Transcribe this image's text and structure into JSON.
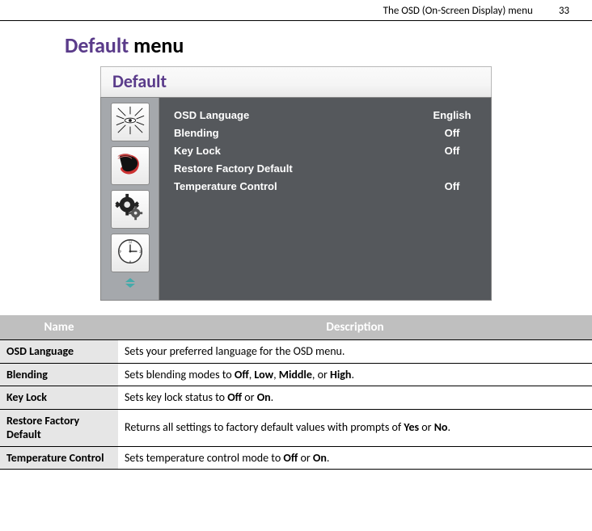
{
  "page_header": {
    "section": "The OSD (On-Screen Display) menu",
    "page_number": "33"
  },
  "page_title_accent": "Default",
  "page_title_rest": " menu",
  "osd": {
    "title": "Default",
    "sidebar_icons": [
      {
        "name": "iris-icon"
      },
      {
        "name": "streamline-icon"
      },
      {
        "name": "gear-icon"
      },
      {
        "name": "clock-icon"
      }
    ],
    "items": [
      {
        "label": "OSD Language",
        "value": "English"
      },
      {
        "label": "Blending",
        "value": "Off"
      },
      {
        "label": "Key Lock",
        "value": "Off"
      },
      {
        "label": "Restore Factory Default",
        "value": ""
      },
      {
        "label": "Temperature Control",
        "value": "Off"
      }
    ]
  },
  "table": {
    "headers": {
      "name": "Name",
      "desc": "Description"
    },
    "rows": [
      {
        "name": "OSD Language",
        "desc_pre": "Sets your preferred language for the OSD menu.",
        "bold1": "",
        "mid1": "",
        "bold2": "",
        "mid2": "",
        "bold3": "",
        "mid3": "",
        "bold4": "",
        "post": ""
      },
      {
        "name": "Blending",
        "desc_pre": "Sets blending modes to ",
        "bold1": "Off",
        "mid1": ", ",
        "bold2": "Low",
        "mid2": ", ",
        "bold3": "Middle",
        "mid3": ", or ",
        "bold4": "High",
        "post": "."
      },
      {
        "name": "Key Lock",
        "desc_pre": "Sets key lock status to ",
        "bold1": "Off",
        "mid1": " or ",
        "bold2": "On",
        "mid2": "",
        "bold3": "",
        "mid3": "",
        "bold4": "",
        "post": "."
      },
      {
        "name": "Restore Factory Default",
        "desc_pre": "Returns all settings to factory default values with prompts of ",
        "bold1": "Yes",
        "mid1": " or ",
        "bold2": "No",
        "mid2": "",
        "bold3": "",
        "mid3": "",
        "bold4": "",
        "post": "."
      },
      {
        "name": "Temperature Control",
        "desc_pre": "Sets temperature control mode to ",
        "bold1": "Off",
        "mid1": " or ",
        "bold2": "On",
        "mid2": "",
        "bold3": "",
        "mid3": "",
        "bold4": "",
        "post": "."
      }
    ]
  }
}
